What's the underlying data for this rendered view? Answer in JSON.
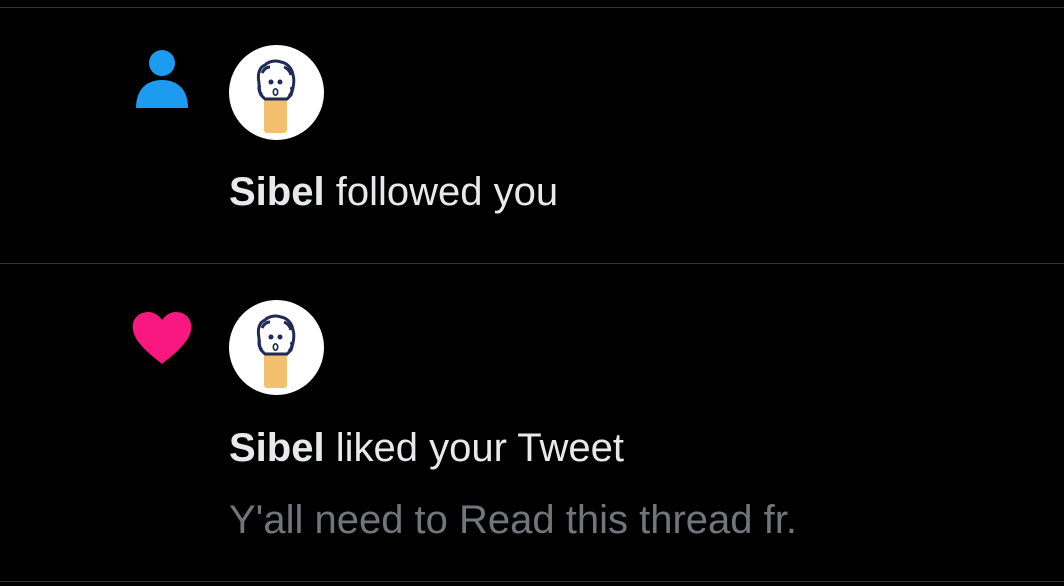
{
  "notifications": [
    {
      "type_icon": "person-icon",
      "icon_color": "#1d9bf0",
      "avatar": "avatar-sibel",
      "user_name": "Sibel",
      "action_text": "followed you"
    },
    {
      "type_icon": "heart-icon",
      "icon_color": "#f91880",
      "avatar": "avatar-sibel",
      "user_name": "Sibel",
      "action_text": "liked your Tweet",
      "tweet_preview": "Y'all need to Read this thread fr."
    }
  ]
}
